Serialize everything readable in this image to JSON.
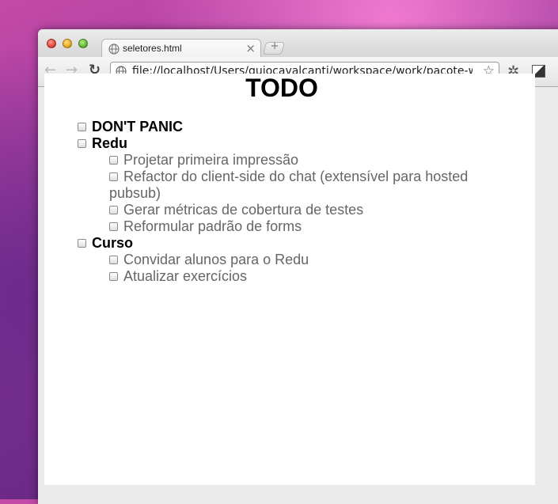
{
  "browser": {
    "tab_title": "seletores.html",
    "tab_close": "×",
    "new_tab": "+",
    "back": "←",
    "forward": "→",
    "reload": "↻",
    "url": "file://localhost/Users/guiocavalcanti/workspace/work/pacote-we...",
    "bookmark": "☆",
    "wrench": "✲"
  },
  "page": {
    "title": "TODO",
    "items": [
      {
        "label": "DON'T PANIC",
        "children": []
      },
      {
        "label": "Redu",
        "children": [
          "Projetar primeira impressão",
          "Refactor do client-side do chat (extensível para hosted pubsub)",
          "Gerar métricas de cobertura de testes",
          "Reformular padrão de forms"
        ]
      },
      {
        "label": "Curso",
        "children": [
          "Convidar alunos para o Redu",
          "Atualizar exercícios"
        ]
      }
    ]
  },
  "colors": {
    "subitem_text": "#666666",
    "top_item_text": "#000000"
  }
}
